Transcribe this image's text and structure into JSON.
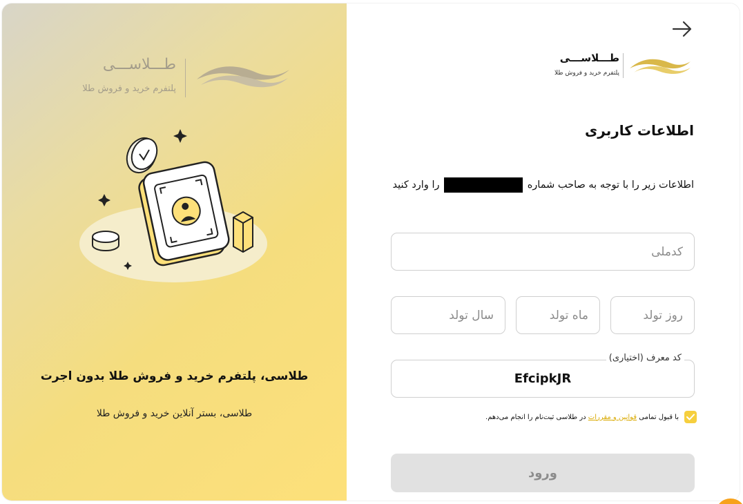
{
  "brand": {
    "name": "طـــلاســـی",
    "tagline": "پلتفرم خرید و فروش طلا"
  },
  "left_panel": {
    "headline": "طلاسی، پلتفرم خرید و فروش طلا بدون اجرت",
    "subheadline": "طلاسی، بستر آنلاین خرید و فروش طلا"
  },
  "form": {
    "title": "اطلاعات کاربری",
    "description_start": "اطلاعات زیر را با توجه به صاحب شماره",
    "description_end": "را وارد کنید",
    "national_code_placeholder": "کدملی",
    "birth_day_placeholder": "روز تولد",
    "birth_month_placeholder": "ماه تولد",
    "birth_year_placeholder": "سال تولد",
    "referral_label": "کد معرف (اختیاری)",
    "referral_value": "EfcipkJR",
    "terms_prefix": "با قبول تمامی",
    "terms_link": "قوانین و مقررات",
    "terms_suffix": "در طلاسی ثبت‌نام را انجام می‌دهم.",
    "terms_checked": true,
    "submit_label": "ورود"
  },
  "colors": {
    "accent": "#f6cf3e",
    "link": "#d9a900",
    "button_disabled": "#e1e1e1"
  },
  "icons": {
    "back": "arrow-right-icon",
    "logo": "gold-wave-logo",
    "check": "check-icon"
  }
}
